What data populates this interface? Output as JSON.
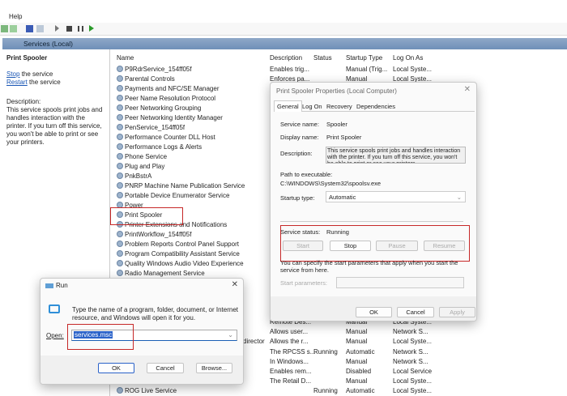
{
  "menu": {
    "help": "Help"
  },
  "header": {
    "title": "Services (Local)"
  },
  "left_pane": {
    "title": "Print Spooler",
    "stop_link": "Stop",
    "stop_suffix": " the service",
    "restart_link": "Restart",
    "restart_suffix": " the service",
    "description_label": "Description:",
    "description": "This service spools print jobs and handles interaction with the printer. If you turn off this service, you won't be able to print or see your printers."
  },
  "columns": {
    "name": "Name",
    "description": "Description",
    "status": "Status",
    "startup": "Startup Type",
    "logon": "Log On As"
  },
  "services": [
    {
      "name": "P9RdrService_154ff05f",
      "description": "Enables trig...",
      "status": "",
      "startup": "Manual (Trig...",
      "logon": "Local Syste..."
    },
    {
      "name": "Parental Controls",
      "description": "Enforces pa...",
      "status": "",
      "startup": "Manual",
      "logon": "Local Syste..."
    },
    {
      "name": "Payments and NFC/SE Manager"
    },
    {
      "name": "Peer Name Resolution Protocol"
    },
    {
      "name": "Peer Networking Grouping"
    },
    {
      "name": "Peer Networking Identity Manager"
    },
    {
      "name": "PenService_154ff05f"
    },
    {
      "name": "Performance Counter DLL Host"
    },
    {
      "name": "Performance Logs & Alerts"
    },
    {
      "name": "Phone Service"
    },
    {
      "name": "Plug and Play"
    },
    {
      "name": "PnkBstrA"
    },
    {
      "name": "PNRP Machine Name Publication Service"
    },
    {
      "name": "Portable Device Enumerator Service"
    },
    {
      "name": "Power"
    },
    {
      "name": "Print Spooler"
    },
    {
      "name": "Printer Extensions and Notifications"
    },
    {
      "name": "PrintWorkflow_154ff05f"
    },
    {
      "name": "Problem Reports Control Panel Support"
    },
    {
      "name": "Program Compatibility Assistant Service"
    },
    {
      "name": "Quality Windows Audio Video Experience"
    },
    {
      "name": "Radio Management Service"
    }
  ],
  "lower_rows": [
    {
      "name": "",
      "description": "Remote Des...",
      "status": "",
      "startup": "Manual",
      "logon": "Local Syste..."
    },
    {
      "name": "",
      "description": "Allows user...",
      "status": "",
      "startup": "Manual",
      "logon": "Network S..."
    },
    {
      "name": "director",
      "description": "Allows the r...",
      "status": "",
      "startup": "Manual",
      "logon": "Local Syste..."
    },
    {
      "name": "",
      "description": "The RPCSS s...",
      "status": "Running",
      "startup": "Automatic",
      "logon": "Network S..."
    },
    {
      "name": "",
      "description": "In Windows...",
      "status": "",
      "startup": "Manual",
      "logon": "Network S..."
    },
    {
      "name": "",
      "description": "Enables rem...",
      "status": "",
      "startup": "Disabled",
      "logon": "Local Service"
    },
    {
      "name": "",
      "description": "The Retail D...",
      "status": "",
      "startup": "Manual",
      "logon": "Local Syste..."
    },
    {
      "name": "ROG Live Service",
      "description": "",
      "status": "Running",
      "startup": "Automatic",
      "logon": "Local Syste..."
    }
  ],
  "properties": {
    "title": "Print Spooler Properties (Local Computer)",
    "tabs": [
      "General",
      "Log On",
      "Recovery",
      "Dependencies"
    ],
    "service_name_label": "Service name:",
    "service_name": "Spooler",
    "display_name_label": "Display name:",
    "display_name": "Print Spooler",
    "description_label": "Description:",
    "description": "This service spools print jobs and handles interaction with the printer.  If you turn off this service, you won't be able to print or see your printers.",
    "path_label": "Path to executable:",
    "path": "C:\\WINDOWS\\System32\\spoolsv.exe",
    "startup_label": "Startup type:",
    "startup_value": "Automatic",
    "status_label": "Service status:",
    "status_value": "Running",
    "start": "Start",
    "stop": "Stop",
    "pause": "Pause",
    "resume": "Resume",
    "hint": "You can specify the start parameters that apply when you start the service from here.",
    "params_label": "Start parameters:",
    "params_value": "",
    "ok": "OK",
    "cancel": "Cancel",
    "apply": "Apply"
  },
  "run": {
    "title": "Run",
    "prompt": "Type the name of a program, folder, document, or Internet resource, and Windows will open it for you.",
    "open_label": "Open:",
    "open_value": "services.msc",
    "ok": "OK",
    "cancel": "Cancel",
    "browse": "Browse..."
  }
}
